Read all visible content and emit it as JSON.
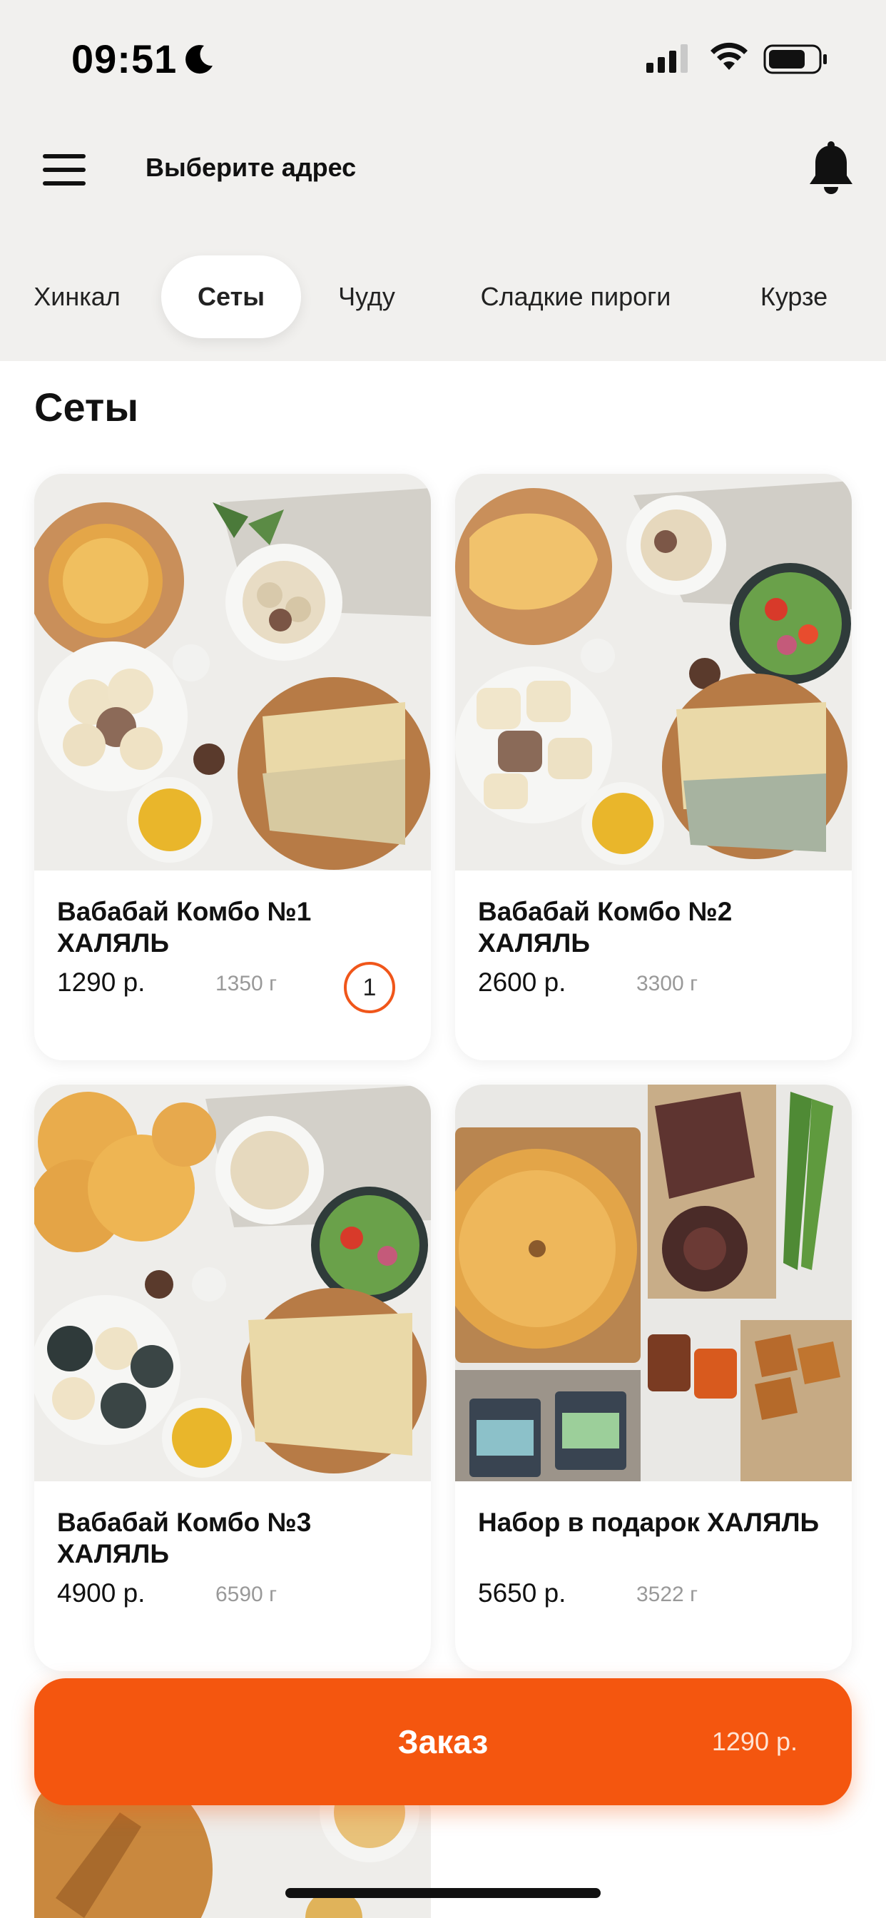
{
  "status_bar": {
    "time": "09:51"
  },
  "header": {
    "address_label": "Выберите адрес"
  },
  "tabs": [
    {
      "label": "Хинкал"
    },
    {
      "label": "Сеты"
    },
    {
      "label": "Чуду"
    },
    {
      "label": "Сладкие пироги"
    },
    {
      "label": "Курзе"
    }
  ],
  "active_tab": "Сеты",
  "section_title": "Сеты",
  "products": [
    {
      "name": "Вабабай Комбо №1 ХАЛЯЛЬ",
      "price": "1290 р.",
      "weight": "1350 г",
      "quantity": "1"
    },
    {
      "name": "Вабабай Комбо №2 ХАЛЯЛЬ",
      "price": "2600 р.",
      "weight": "3300 г"
    },
    {
      "name": "Вабабай Комбо №3 ХАЛЯЛЬ",
      "price": "4900 р.",
      "weight": "6590 г"
    },
    {
      "name": "Набор в подарок ХАЛЯЛЬ",
      "price": "5650 р.",
      "weight": "3522 г"
    }
  ],
  "order_button": {
    "label": "Заказ",
    "total": "1290 р."
  },
  "colors": {
    "accent": "#f4560f",
    "background": "#f1f0ee"
  }
}
